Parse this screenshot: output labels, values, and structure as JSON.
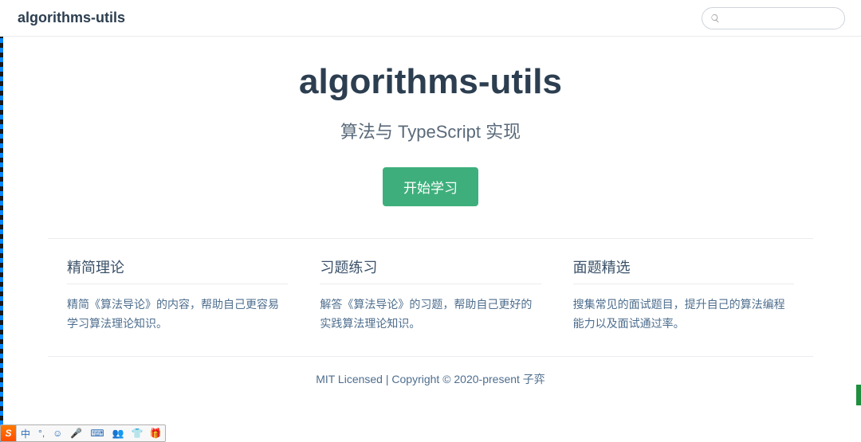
{
  "nav": {
    "title": "algorithms-utils"
  },
  "search": {
    "placeholder": ""
  },
  "hero": {
    "title": "algorithms-utils",
    "description": "算法与 TypeScript 实现",
    "action_label": "开始学习"
  },
  "features": [
    {
      "title": "精简理论",
      "text": "精简《算法导论》的内容，帮助自己更容易学习算法理论知识。"
    },
    {
      "title": "习题练习",
      "text": "解答《算法导论》的习题，帮助自己更好的实践算法理论知识。"
    },
    {
      "title": "面题精选",
      "text": "搜集常见的面试题目，提升自己的算法编程能力以及面试通过率。"
    }
  ],
  "footer": {
    "text": "MIT Licensed | Copyright © 2020-present 子弈"
  },
  "ime": {
    "logo": "S",
    "items": [
      "中",
      "°,",
      "☺",
      "🎤",
      "⌨",
      "👥",
      "👕",
      "🎁"
    ]
  }
}
